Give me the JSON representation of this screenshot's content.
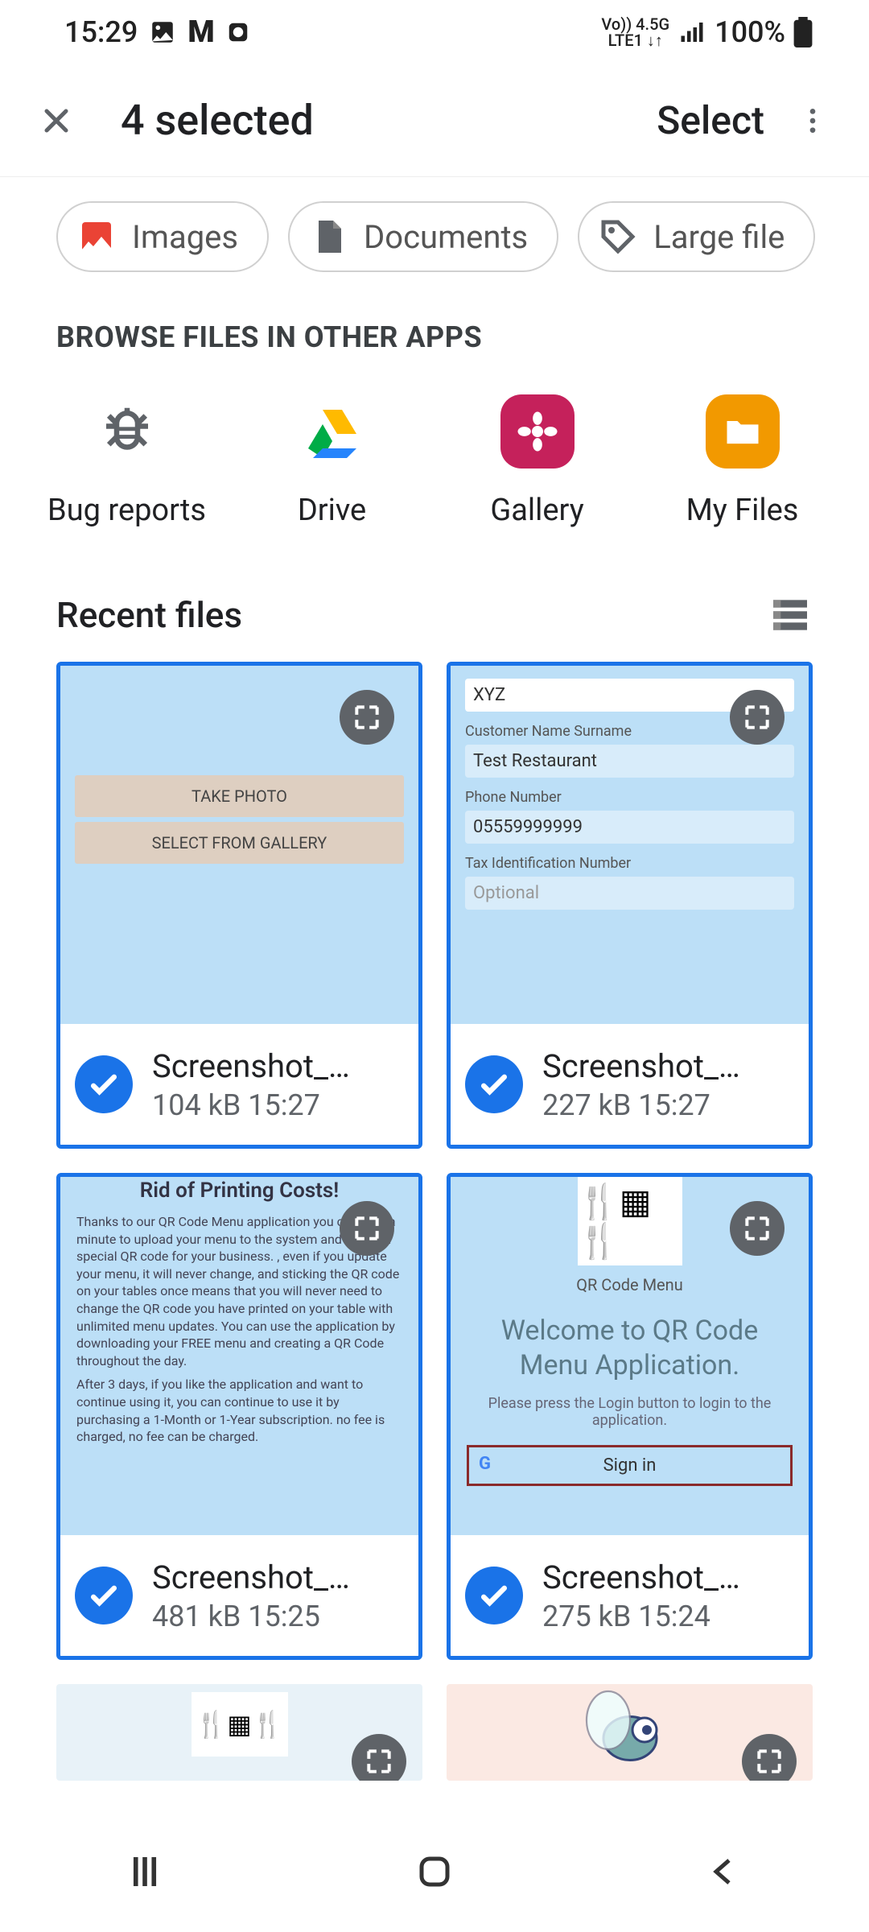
{
  "status": {
    "time": "15:29",
    "net_small": "Vo)) 4.5G",
    "net_small2": "LTE1 ↓↑",
    "battery": "100%"
  },
  "appbar": {
    "title": "4 selected",
    "select_label": "Select"
  },
  "chips": {
    "images": "Images",
    "documents": "Documents",
    "large": "Large file"
  },
  "section_browse": "BROWSE FILES IN OTHER APPS",
  "apps": {
    "bug": "Bug reports",
    "drive": "Drive",
    "gallery": "Gallery",
    "myfiles": "My Files"
  },
  "recent": {
    "title": "Recent files"
  },
  "files": [
    {
      "name": "Screenshot_…",
      "sub": "104 kB 15:27"
    },
    {
      "name": "Screenshot_…",
      "sub": "227 kB 15:27"
    },
    {
      "name": "Screenshot_…",
      "sub": "481 kB 15:25"
    },
    {
      "name": "Screenshot_…",
      "sub": "275 kB 15:24"
    }
  ],
  "thumb1": {
    "take": "TAKE PHOTO",
    "gallery": "SELECT FROM GALLERY"
  },
  "thumb2": {
    "top": "XYZ",
    "l1": "Customer Name Surname",
    "v1": "Test Restaurant",
    "l2": "Phone Number",
    "v2": "05559999999",
    "l3": "Tax Identification Number",
    "v3": "Optional"
  },
  "thumb3": {
    "title": "Rid of Printing Costs!",
    "p1": "Thanks to our QR Code Menu application you can take a minute to upload your menu to the system and create a special QR code for your business. , even if you update your menu, it will never change, and sticking the QR code on your tables once means that you will never need to change the QR code you have printed on your table with unlimited menu updates. You can use the application by downloading your FREE menu and creating a QR Code throughout the day.",
    "p2": "After 3 days, if you like the application and want to continue using it, you can continue to use it by purchasing a 1-Month or 1-Year subscription. no fee is charged, no fee can be charged."
  },
  "thumb4": {
    "sub": "QR Code Menu",
    "title": "Welcome to QR Code Menu Application.",
    "hint": "Please press the Login button to login to the application.",
    "signin": "Sign in"
  }
}
